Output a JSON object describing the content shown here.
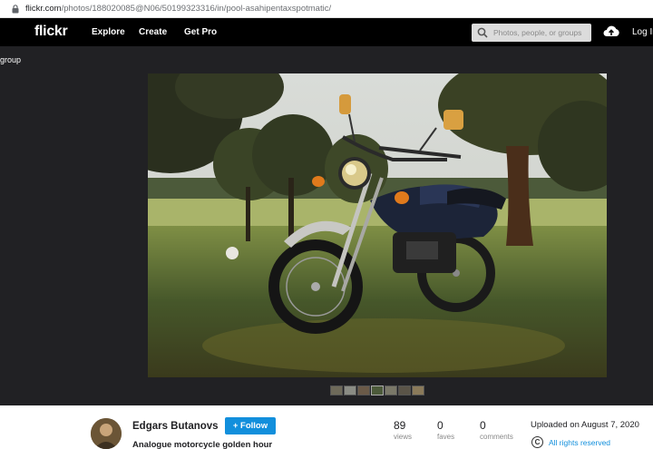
{
  "browser": {
    "url_host": "flickr.com",
    "url_path": "/photos/188020085@N06/50199323316/in/pool-asahipentaxspotmatic/"
  },
  "nav": {
    "logo": "flickr",
    "links": [
      "Explore",
      "Create",
      "Get Pro"
    ],
    "search_placeholder": "Photos, people, or groups",
    "login": "Log In"
  },
  "back_link": "group",
  "photo": {
    "alt": "Analogue motorcycle golden hour",
    "thumbnail_count": 7
  },
  "info": {
    "author": "Edgars Butanovs",
    "follow_label": "+ Follow",
    "title": "Analogue motorcycle golden hour",
    "stats": [
      {
        "value": "89",
        "label": "views"
      },
      {
        "value": "0",
        "label": "faves"
      },
      {
        "value": "0",
        "label": "comments"
      }
    ],
    "uploaded": "Uploaded on August 7, 2020",
    "rights_symbol": "C",
    "rights": "All rights reserved"
  },
  "colors": {
    "nav_bg": "#000000",
    "page_bg": "#212124",
    "accent": "#128fdc"
  }
}
